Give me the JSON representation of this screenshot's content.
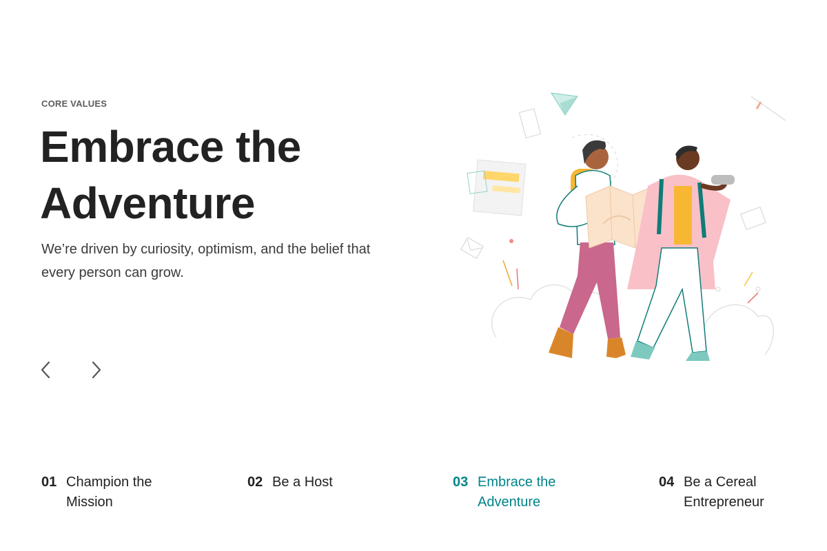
{
  "section": {
    "eyebrow": "CORE VALUES",
    "headline_line1": "Embrace the",
    "headline_line2": "Adventure",
    "description": "We’re driven by curiosity, optimism, and the belief that every person can grow."
  },
  "carousel": {
    "prev_icon": "chevron-left-icon",
    "next_icon": "chevron-right-icon"
  },
  "values": [
    {
      "number": "01",
      "label": "Champion the Mission",
      "active": false
    },
    {
      "number": "02",
      "label": "Be a Host",
      "active": false
    },
    {
      "number": "03",
      "label": "Embrace the Adventure",
      "active": true
    },
    {
      "number": "04",
      "label": "Be a Cereal Entrepreneur",
      "active": false
    }
  ],
  "colors": {
    "text": "#222222",
    "muted": "#5c5c5c",
    "accent": "#008489"
  }
}
